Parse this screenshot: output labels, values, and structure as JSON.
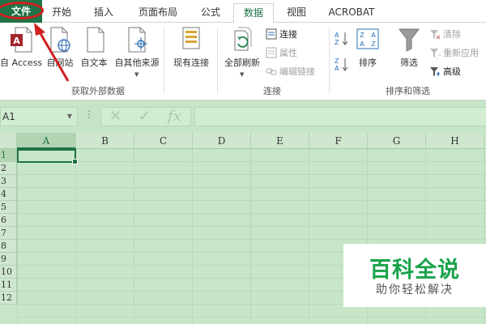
{
  "tabs": [
    {
      "label": "文件",
      "name": "tab-file"
    },
    {
      "label": "开始",
      "name": "tab-home"
    },
    {
      "label": "插入",
      "name": "tab-insert"
    },
    {
      "label": "页面布局",
      "name": "tab-page-layout"
    },
    {
      "label": "公式",
      "name": "tab-formulas"
    },
    {
      "label": "数据",
      "name": "tab-data",
      "active": true
    },
    {
      "label": "视图",
      "name": "tab-view"
    },
    {
      "label": "ACROBAT",
      "name": "tab-acrobat"
    }
  ],
  "ribbon": {
    "external": {
      "access": "自 Access",
      "web": "自网站",
      "text": "自文本",
      "other": "自其他来源",
      "group_label": "获取外部数据"
    },
    "existing": "现有连接",
    "connections": {
      "refresh_all": "全部刷新",
      "connect": "连接",
      "properties": "属性",
      "edit_links": "编辑链接",
      "group_label": "连接"
    },
    "sort_filter": {
      "sort": "排序",
      "filter": "筛选",
      "clear": "清除",
      "reapply": "重新应用",
      "advanced": "高级",
      "group_label": "排序和筛选"
    }
  },
  "formula_bar": {
    "name_box": "A1",
    "fx": "fx",
    "cancel": "✕",
    "enter": "✓",
    "dots": "⋮",
    "value": ""
  },
  "grid": {
    "columns": [
      "A",
      "B",
      "C",
      "D",
      "E",
      "F",
      "G",
      "H"
    ],
    "rows": [
      "1",
      "2",
      "3",
      "4",
      "5",
      "6",
      "7",
      "8",
      "9",
      "10",
      "11",
      "12"
    ],
    "selected_cell": "A1"
  },
  "watermark": {
    "title": "百科全说",
    "subtitle": "助你轻松解决"
  },
  "colors": {
    "excel_green": "#217346",
    "sheet_bg": "#c7e6c7",
    "annotation_red": "#d02020",
    "watermark_green": "#1aa34a"
  }
}
